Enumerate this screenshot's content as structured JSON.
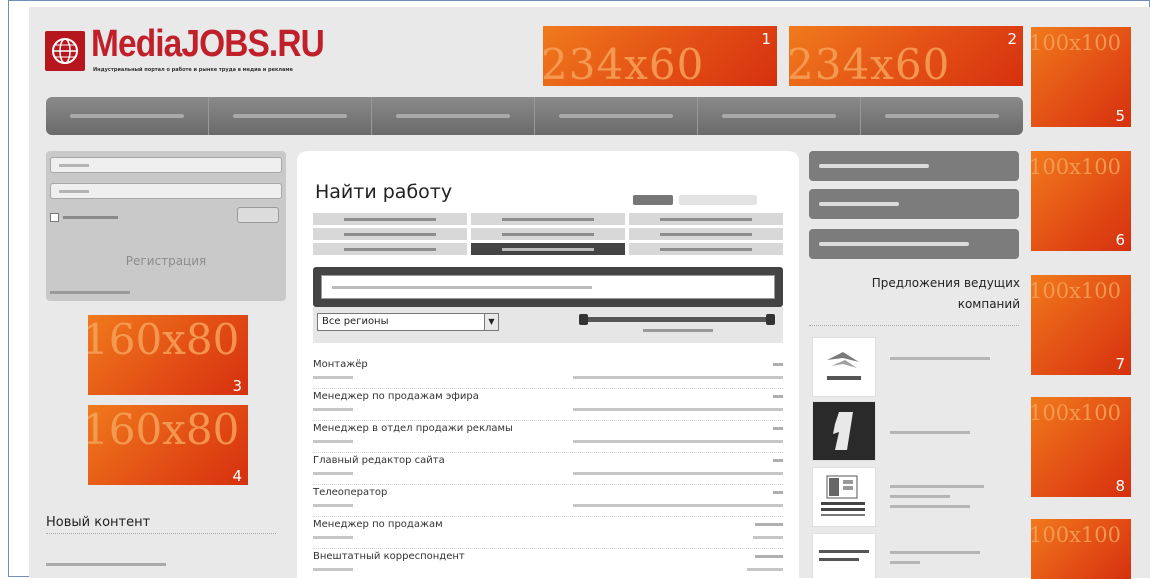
{
  "logo": {
    "name": "MediaJOBS.RU",
    "tagline": "Индустриальный портал о работе и рынке труда в медиа и рекламе"
  },
  "banners_top": [
    {
      "text": "234x60",
      "num": "1"
    },
    {
      "text": "234x60",
      "num": "2"
    }
  ],
  "banners_left": [
    {
      "text": "160x80",
      "num": "3"
    },
    {
      "text": "160x80",
      "num": "4"
    }
  ],
  "banners_right": [
    {
      "text": "100x100",
      "num": "5"
    },
    {
      "text": "100x100",
      "num": "6"
    },
    {
      "text": "100x100",
      "num": "7"
    },
    {
      "text": "100x100",
      "num": "8"
    },
    {
      "text": "100x100",
      "num": ""
    }
  ],
  "login": {
    "register_label": "Регистрация"
  },
  "left": {
    "new_content_title": "Новый контент"
  },
  "search": {
    "title": "Найти работу",
    "region_value": "Все регионы",
    "region_arrow": "▼"
  },
  "jobs": [
    {
      "title": "Монтажёр"
    },
    {
      "title": "Менеджер по продажам эфира"
    },
    {
      "title": "Менеджер в отдел продажи рекламы"
    },
    {
      "title": "Главный редактор сайта"
    },
    {
      "title": "Телеоператор"
    },
    {
      "title": "Менеджер по продажам"
    },
    {
      "title": "Внештатный корреспондент"
    }
  ],
  "offers": {
    "title_line1": "Предложения ведущих",
    "title_line2": "компаний"
  },
  "colors": {
    "brand": "#c0202a",
    "banner": "#e34f15",
    "nav": "#777777"
  }
}
